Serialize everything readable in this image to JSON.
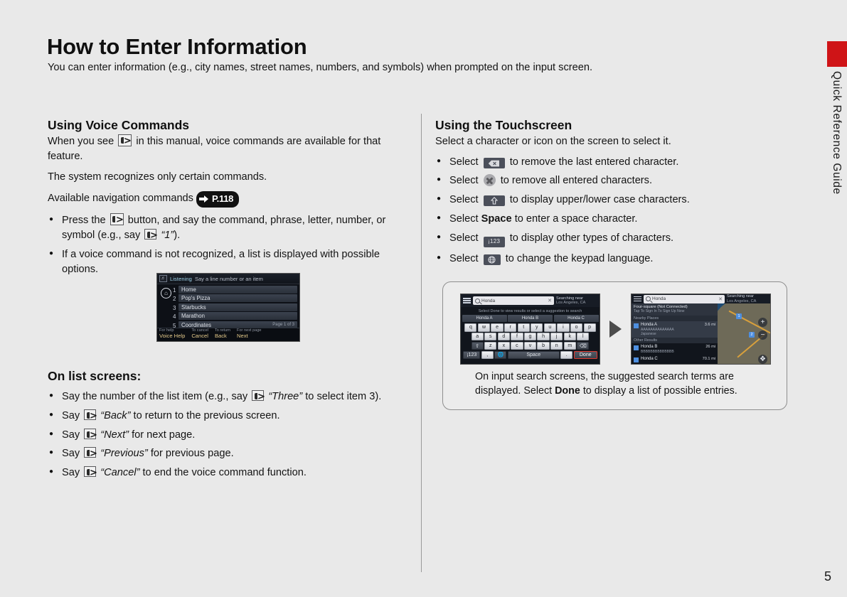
{
  "side_tab": {
    "label": "Quick Reference Guide"
  },
  "header": {
    "title": "How to Enter Information",
    "intro": "You can enter information (e.g., city names, street names, numbers, and symbols) when prompted on the input screen."
  },
  "page_number": "5",
  "left_column": {
    "section_title": "Using Voice Commands",
    "line1_a": "When you see",
    "line1_b": "in this manual, voice commands are available for that feature.",
    "line2": "The system recognizes only certain commands.",
    "line3": "Available navigation commands",
    "page_ref": "P.118",
    "bullets": [
      {
        "a": "Press the",
        "b": "button, and say the command, phrase, letter, number, or symbol (e.g., say",
        "quote": "“1”",
        "c": ")."
      },
      {
        "text": "If a voice command is not recognized, a list is displayed with possible options."
      }
    ],
    "list_section_title": "On list screens:",
    "list_bullets": [
      {
        "a": "Say the number of the list item (e.g., say",
        "quote": "“Three”",
        "b": "to select item 3)."
      },
      {
        "a": "Say",
        "quote": "“Back”",
        "b": "to return to the previous screen."
      },
      {
        "a": "Say",
        "quote": "“Next”",
        "b": "for next page."
      },
      {
        "a": "Say",
        "quote": "“Previous”",
        "b": "for previous page."
      },
      {
        "a": "Say",
        "quote": "“Cancel”",
        "b": "to end the voice command function."
      }
    ]
  },
  "nav_screenshot": {
    "status_listening": "Listening",
    "status_hint": "Say a line number or an item",
    "home_icon": "home-icon",
    "numbers": [
      "1",
      "2",
      "3",
      "4",
      "5"
    ],
    "rows": [
      {
        "label": "Home",
        "page": ""
      },
      {
        "label": "Pop's Pizza",
        "page": ""
      },
      {
        "label": "Starbucks",
        "page": ""
      },
      {
        "label": "Marathon",
        "page": ""
      },
      {
        "label": "Coordinates",
        "page": "Page 1 of 3"
      }
    ],
    "bottom_bar": [
      {
        "sub": "For help",
        "main": "Voice Help"
      },
      {
        "sub": "To cancel",
        "main": "Cancel"
      },
      {
        "sub": "To return",
        "main": "Back"
      },
      {
        "sub": "For next page",
        "main": "Next"
      }
    ]
  },
  "right_column": {
    "section_title": "Using the Touchscreen",
    "intro": "Select a character or icon on the screen to select it.",
    "bullets": [
      {
        "a": "Select",
        "icon": "backspace-key",
        "b": "to remove the last entered character."
      },
      {
        "a": "Select",
        "icon": "clear-all-x-icon",
        "b": "to remove all entered characters."
      },
      {
        "a": "Select",
        "icon": "shift-key",
        "b": "to display upper/lower case characters."
      },
      {
        "a": "Select",
        "strong": "Space",
        "b": "to enter a space character."
      },
      {
        "a": "Select",
        "icon": "symbols-123-key",
        "icon_label": "¡123",
        "b": "to display other types of characters."
      },
      {
        "a": "Select",
        "icon": "globe-key",
        "b": "to change the keypad language."
      }
    ]
  },
  "illustration": {
    "keyboard_screen": {
      "menu_icon": "hamburger-menu-icon",
      "search_icon": "search-icon",
      "search_value": "Honda",
      "clear_icon": "clear-x-icon",
      "near_label": "Searching near",
      "near_value": "Los Angeles, CA",
      "note": "Select Done to view results or select a suggestion to search",
      "suggestions": [
        "Honda A",
        "Honda B",
        "Honda C"
      ],
      "rows": [
        [
          "q",
          "w",
          "e",
          "r",
          "t",
          "y",
          "u",
          "i",
          "o",
          "p"
        ],
        [
          "a",
          "s",
          "d",
          "f",
          "g",
          "h",
          "j",
          "k",
          "l"
        ],
        [
          "z",
          "x",
          "c",
          "v",
          "b",
          "n",
          "m"
        ]
      ],
      "shift_key": "shift-key",
      "backspace_key": "backspace-key",
      "sym_key": "¡123",
      "comma_key": ",",
      "globe_key": "globe-key",
      "space_key": "Space",
      "period_key": ".",
      "done_key": "Done"
    },
    "results_screen": {
      "menu_icon": "hamburger-menu-icon",
      "search_icon": "search-icon",
      "search_value": "Honda",
      "clear_icon": "clear-x-icon",
      "near_label": "Searching near",
      "near_value": "Los Angeles, CA",
      "banner_title": "Four-square (Not Connected)",
      "banner_sub": "Tap To Sign In To Sign Up Now",
      "group1": "Nearby Places",
      "group2": "Other Results",
      "items": [
        {
          "title": "Honda A",
          "sub": "AAAAAAAAAAAAAA",
          "sub2": "Japanese",
          "dist": "3.6 mi"
        },
        {
          "title": "Honda B",
          "sub": "BBBBBBBBBBBBBB",
          "dist": "26 mi"
        },
        {
          "title": "Honda C",
          "sub": "",
          "dist": "70.1 mi"
        }
      ],
      "map_pins": [
        "1",
        "2"
      ],
      "zoom_in": "+",
      "zoom_out": "−",
      "expand_icon": "expand-icon"
    },
    "caption_a": "On input search screens, the suggested search terms are displayed. Select",
    "caption_bold": "Done",
    "caption_b": "to display a list of possible entries."
  }
}
